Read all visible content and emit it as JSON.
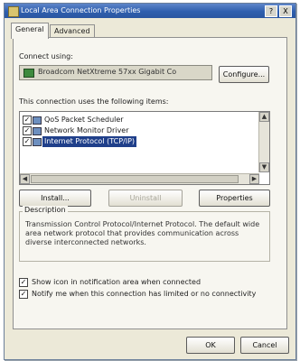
{
  "window": {
    "title": "Local Area Connection Properties",
    "help_label": "?",
    "close_label": "X"
  },
  "tabs": [
    {
      "label": "General",
      "active": true
    },
    {
      "label": "Advanced",
      "active": false
    }
  ],
  "connect_using": {
    "label": "Connect using:",
    "adapter": "Broadcom NetXtreme 57xx Gigabit Co",
    "configure_label": "Configure..."
  },
  "items_section": {
    "label": "This connection uses the following items:",
    "items": [
      {
        "label": "QoS Packet Scheduler",
        "checked": true
      },
      {
        "label": "Network Monitor Driver",
        "checked": true
      },
      {
        "label": "Internet Protocol (TCP/IP)",
        "checked": true,
        "selected": true
      }
    ]
  },
  "actions": {
    "install": "Install...",
    "uninstall": "Uninstall",
    "properties": "Properties"
  },
  "description": {
    "title": "Description",
    "text": "Transmission Control Protocol/Internet Protocol. The default wide area network protocol that provides communication across diverse interconnected networks."
  },
  "options": [
    {
      "label": "Show icon in notification area when connected",
      "checked": true
    },
    {
      "label": "Notify me when this connection has limited or no connectivity",
      "checked": true
    }
  ],
  "footer": {
    "ok": "OK",
    "cancel": "Cancel"
  }
}
